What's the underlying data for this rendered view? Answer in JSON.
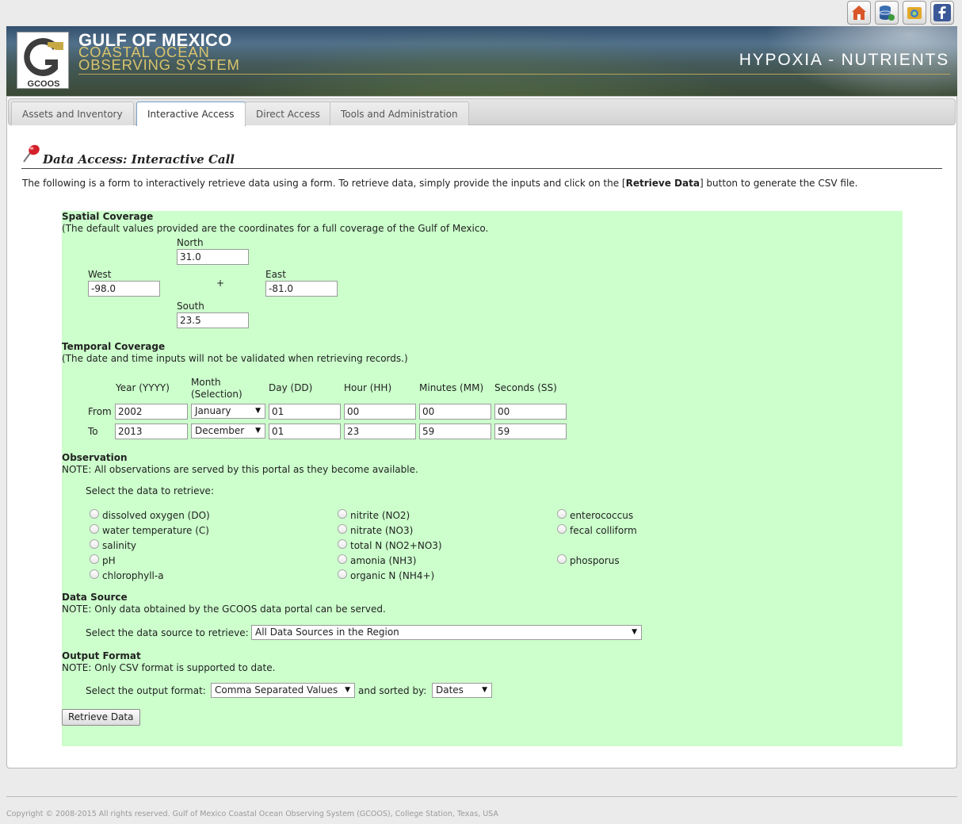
{
  "header": {
    "icons": [
      "home-icon",
      "database-icon",
      "camera-icon",
      "facebook-icon"
    ],
    "org_line1": "GULF OF MEXICO",
    "org_line2": "COASTAL OCEAN",
    "org_line3": "OBSERVING SYSTEM",
    "logo_letters": "GCOOS",
    "project": "HYPOXIA - NUTRIENTS"
  },
  "tabs": [
    {
      "label": "Assets and Inventory",
      "active": false
    },
    {
      "label": "Interactive Access",
      "active": true
    },
    {
      "label": "Direct Access",
      "active": false
    },
    {
      "label": "Tools and Administration",
      "active": false
    }
  ],
  "page": {
    "title": "Data Access: Interactive Call",
    "intro_before": "The following is a form to interactively retrieve data using a form. To retrieve data, simply provide the inputs and click on the [",
    "intro_bold": "Retrieve Data",
    "intro_after": "] button to generate the CSV file."
  },
  "spatial": {
    "title": "Spatial Coverage",
    "note": "(The default values provided are the coordinates for a full coverage of the Gulf of Mexico.",
    "north_label": "North",
    "north_value": "31.0",
    "west_label": "West",
    "west_value": "-98.0",
    "east_label": "East",
    "east_value": "-81.0",
    "south_label": "South",
    "south_value": "23.5",
    "center_mark": "+"
  },
  "temporal": {
    "title": "Temporal Coverage",
    "note": "(The date and time inputs will not be validated when retrieving records.)",
    "headers": {
      "year": "Year (YYYY)",
      "month_1": "Month",
      "month_2": "(Selection)",
      "day": "Day (DD)",
      "hour": "Hour (HH)",
      "minutes": "Minutes (MM)",
      "seconds": "Seconds (SS)"
    },
    "from": {
      "label": "From",
      "year": "2002",
      "month": "January",
      "day": "01",
      "hour": "00",
      "minutes": "00",
      "seconds": "00"
    },
    "to": {
      "label": "To",
      "year": "2013",
      "month": "December",
      "day": "01",
      "hour": "23",
      "minutes": "59",
      "seconds": "59"
    }
  },
  "observation": {
    "title": "Observation",
    "note": "NOTE: All observations are served by this portal as they become available.",
    "prompt": "Select the data to retrieve:",
    "col1": [
      "dissolved oxygen (DO)",
      "water temperature (C)",
      "salinity",
      "pH",
      "chlorophyll-a"
    ],
    "col2": [
      "nitrite (NO2)",
      "nitrate (NO3)",
      "total N (NO2+NO3)",
      "amonia (NH3)",
      "organic N (NH4+)"
    ],
    "col3": [
      "enterococcus",
      "fecal colliform",
      "phosporus"
    ]
  },
  "source": {
    "title": "Data Source",
    "note": "NOTE: Only data obtained by the GCOOS data portal can be served.",
    "prompt": "Select the data source to retrieve:",
    "value": "All Data Sources in the Region"
  },
  "output": {
    "title": "Output Format",
    "note": "NOTE: Only CSV format is supported to date.",
    "prompt": "Select the output format:",
    "format_value": "Comma Separated Values",
    "sorted_label": "and sorted by:",
    "sort_value": "Dates",
    "button": "Retrieve Data"
  },
  "footer": {
    "copyright": "Copyright © 2008-2015 All rights reserved. Gulf of Mexico Coastal Ocean Observing System (GCOOS), College Station, Texas, USA"
  },
  "colors": {
    "form_background": "#ccffcc",
    "logo_gold": "#d8c36b",
    "active_tab_border": "#7aa0c8"
  }
}
